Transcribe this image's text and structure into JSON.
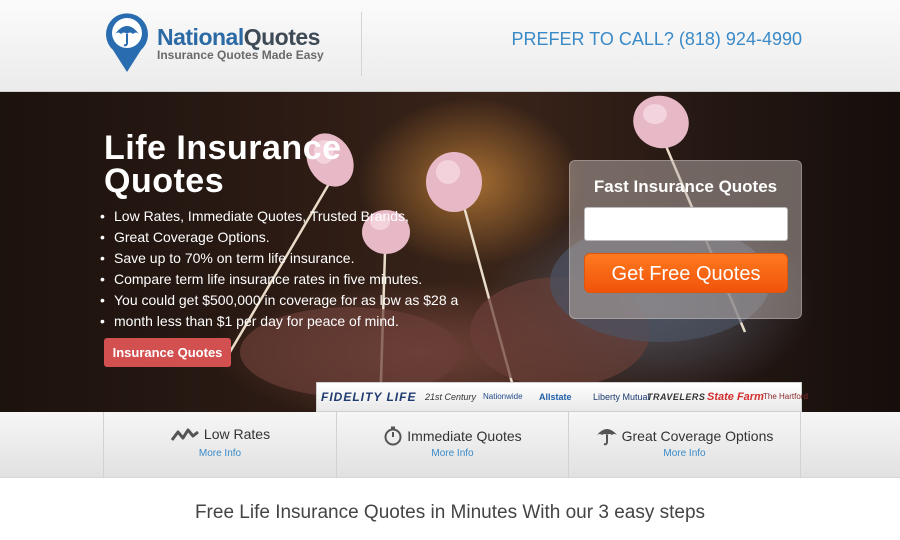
{
  "header": {
    "logo_name_a": "National",
    "logo_name_b": "Quotes",
    "logo_tagline": "Insurance Quotes Made Easy",
    "phone": "PREFER TO CALL? (818) 924-4990"
  },
  "hero": {
    "title_line1": "Life Insurance",
    "title_line2": "Quotes",
    "bullets": [
      "Low Rates, Immediate Quotes, Trusted Brands,",
      "Great Coverage Options.",
      "Save up to 70% on term life insurance.",
      "Compare term life insurance rates in five minutes.",
      "You could get $500,000 in coverage for as low as $28 a",
      "month less than $1 per day for peace of mind."
    ],
    "cta_label": "Insurance Quotes"
  },
  "quote_form": {
    "title": "Fast Insurance Quotes",
    "input_value": "",
    "button_label": "Get Free Quotes"
  },
  "brands": [
    "FIDELITY LIFE",
    "21st Century",
    "Nationwide",
    "Allstate",
    "Liberty Mutual",
    "TRAVELERS",
    "State Farm",
    "The Hartford"
  ],
  "features": [
    {
      "title": "Low Rates",
      "link": "More Info",
      "icon": "trend-icon"
    },
    {
      "title": "Immediate Quotes",
      "link": "More Info",
      "icon": "stopwatch-icon"
    },
    {
      "title": "Great Coverage Options",
      "link": "More Info",
      "icon": "umbrella-icon"
    }
  ],
  "steps": {
    "title": "Free Life Insurance Quotes in Minutes With our 3 easy steps"
  },
  "colors": {
    "brand_blue": "#2c6aa6",
    "phone_blue": "#3a8ac8",
    "cta_red": "#d2504f",
    "button_orange": "#f0530a"
  }
}
